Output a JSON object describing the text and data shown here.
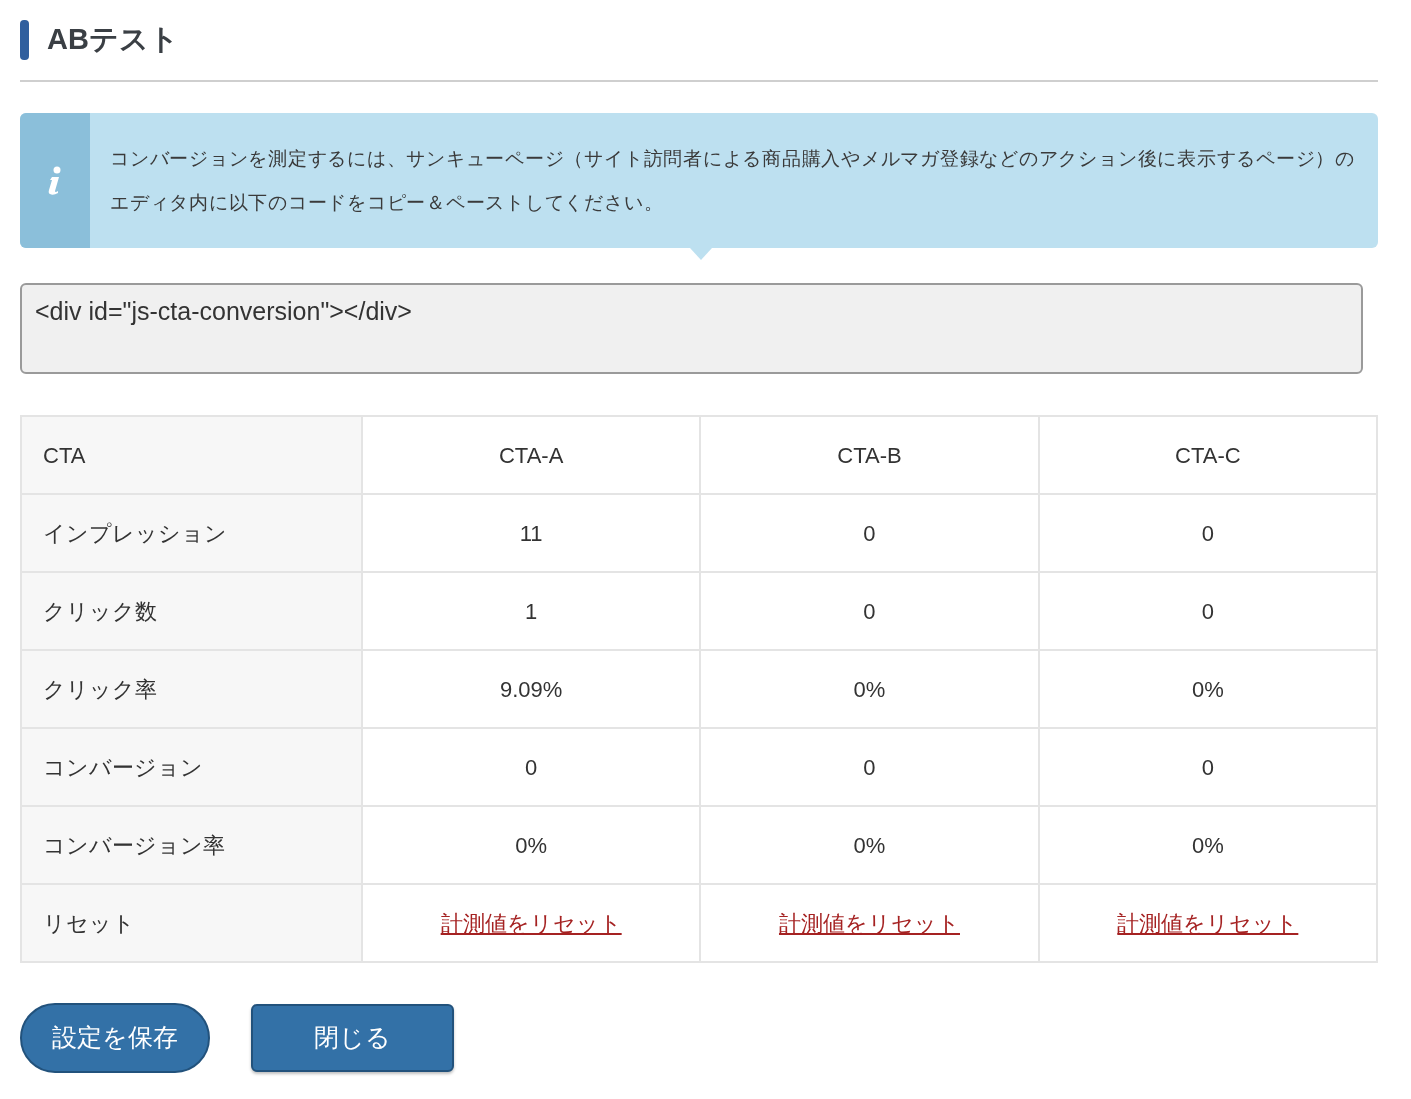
{
  "title": "ABテスト",
  "notice": "コンバージョンを測定するには、サンキューページ（サイト訪問者による商品購入やメルマガ登録などのアクション後に表示するページ）のエディタ内に以下のコードをコピー＆ペーストしてください。",
  "code_field": {
    "value": "<div id=\"js-cta-conversion\"></div>"
  },
  "table": {
    "columns": [
      "CTA",
      "CTA-A",
      "CTA-B",
      "CTA-C"
    ],
    "rows": [
      {
        "kind": "text",
        "cells": [
          "インプレッション",
          "11",
          "0",
          "0"
        ]
      },
      {
        "kind": "text",
        "cells": [
          "クリック数",
          "1",
          "0",
          "0"
        ]
      },
      {
        "kind": "text",
        "cells": [
          "クリック率",
          "9.09%",
          "0%",
          "0%"
        ]
      },
      {
        "kind": "text",
        "cells": [
          "コンバージョン",
          "0",
          "0",
          "0"
        ]
      },
      {
        "kind": "text",
        "cells": [
          "コンバージョン率",
          "0%",
          "0%",
          "0%"
        ]
      },
      {
        "kind": "link",
        "cells": [
          "リセット",
          "計測値をリセット",
          "計測値をリセット",
          "計測値をリセット"
        ]
      }
    ]
  },
  "buttons": [
    {
      "label": "設定を保存",
      "kind": "pill"
    },
    {
      "label": "閉じる",
      "kind": "square"
    }
  ]
}
